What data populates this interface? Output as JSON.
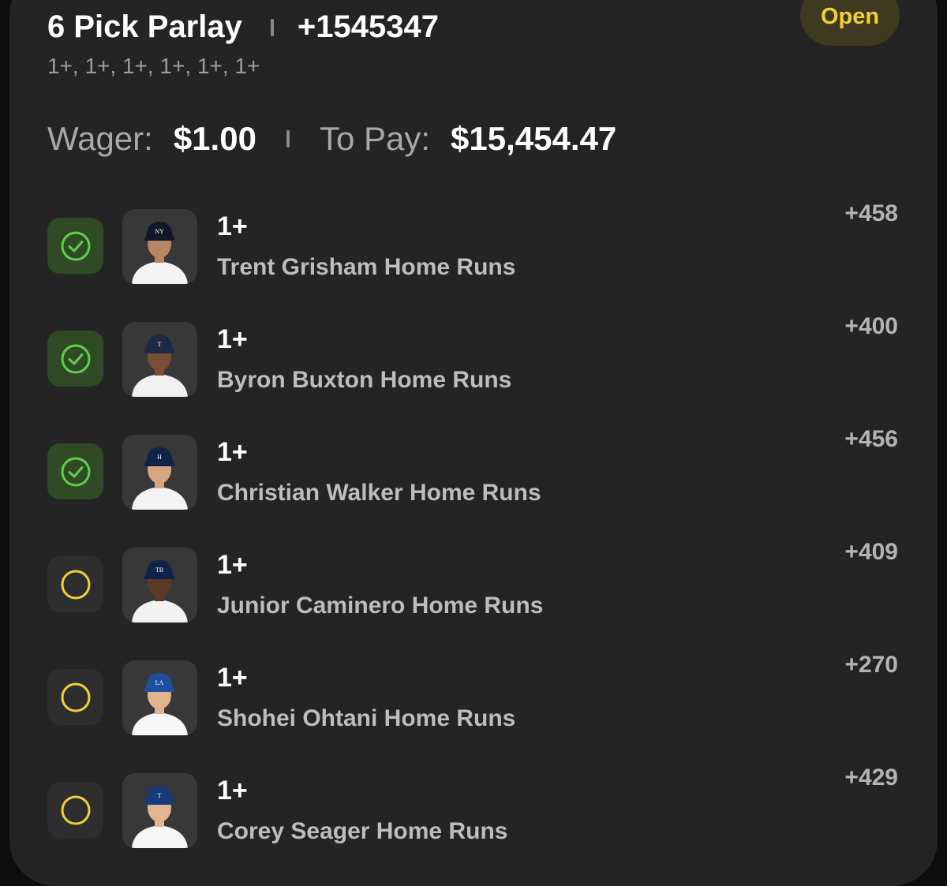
{
  "bet": {
    "title": "6 Pick Parlay",
    "odds": "+1545347",
    "lines_summary": "1+, 1+, 1+, 1+, 1+, 1+",
    "status": "Open",
    "wager_label": "Wager:",
    "wager_value": "$1.00",
    "payout_label": "To Pay:",
    "payout_value": "$15,454.47"
  },
  "colors": {
    "won_green": "#5fd04a",
    "open_yellow": "#f2cf3a",
    "card_bg": "#242424"
  },
  "legs": [
    {
      "status": "won",
      "status_icon": "check-circle-icon",
      "line": "1+",
      "market": "Trent Grisham Home Runs",
      "odds": "+458",
      "cap_color": "#101828",
      "jersey": "#f4f4f4",
      "skin": "#b88662",
      "logo": "NY"
    },
    {
      "status": "won",
      "status_icon": "check-circle-icon",
      "line": "1+",
      "market": "Byron Buxton Home Runs",
      "odds": "+400",
      "cap_color": "#1c2a45",
      "jersey": "#f0f0f0",
      "skin": "#7a4e34",
      "logo": "T"
    },
    {
      "status": "won",
      "status_icon": "check-circle-icon",
      "line": "1+",
      "market": "Christian Walker Home Runs",
      "odds": "+456",
      "cap_color": "#0e2347",
      "jersey": "#f4f4f4",
      "skin": "#d7a582",
      "logo": "H"
    },
    {
      "status": "open",
      "status_icon": "open-circle-icon",
      "line": "1+",
      "market": "Junior Caminero Home Runs",
      "odds": "+409",
      "cap_color": "#0d2448",
      "jersey": "#f2f2f2",
      "skin": "#5b3a28",
      "logo": "TB"
    },
    {
      "status": "open",
      "status_icon": "open-circle-icon",
      "line": "1+",
      "market": "Shohei Ohtani Home Runs",
      "odds": "+270",
      "cap_color": "#1f4e9c",
      "jersey": "#f6f6f6",
      "skin": "#e0b48c",
      "logo": "LA"
    },
    {
      "status": "open",
      "status_icon": "open-circle-icon",
      "line": "1+",
      "market": "Corey Seager Home Runs",
      "odds": "+429",
      "cap_color": "#163a7a",
      "jersey": "#f6f6f6",
      "skin": "#e3b592",
      "logo": "T"
    }
  ]
}
